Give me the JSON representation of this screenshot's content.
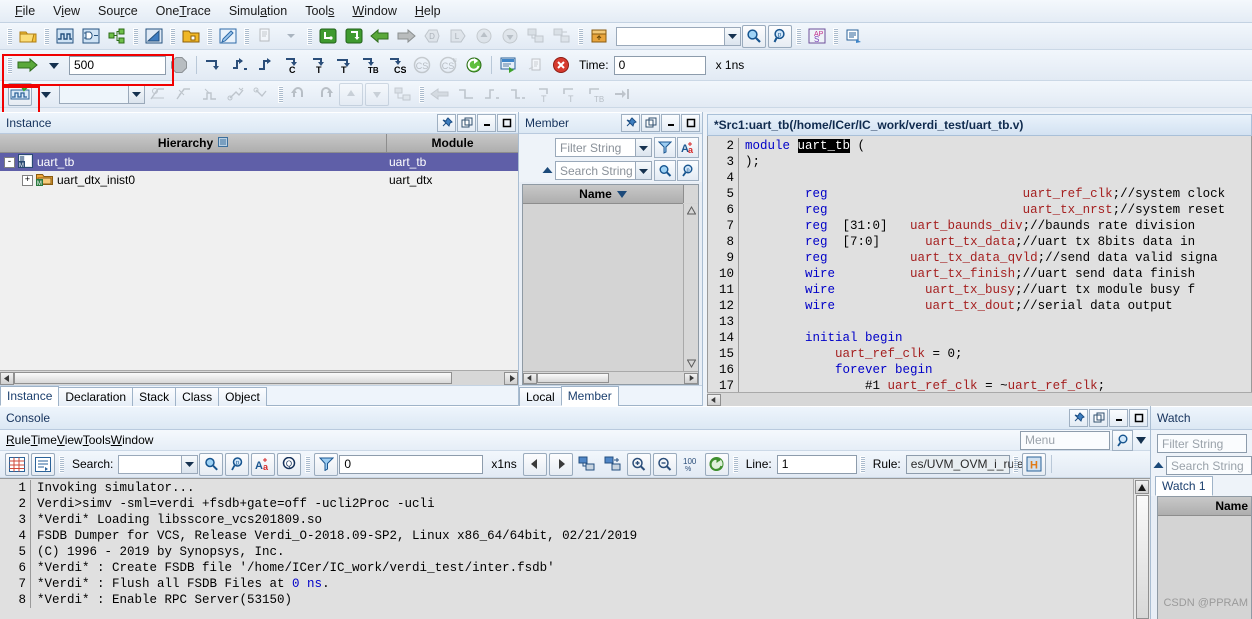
{
  "app": {
    "menu": [
      {
        "label": "File",
        "accel": "F"
      },
      {
        "label": "View",
        "accel": "V"
      },
      {
        "label": "Source",
        "accel": "r"
      },
      {
        "label": "OneTrace",
        "accel": "T"
      },
      {
        "label": "Simulation",
        "accel": "a"
      },
      {
        "label": "Tools",
        "accel": "s"
      },
      {
        "label": "Window",
        "accel": "W"
      },
      {
        "label": "Help",
        "accel": "H"
      }
    ]
  },
  "toolbar_run": {
    "steps_value": "500",
    "steps_placeholder": "",
    "time_label": "Time:",
    "time_value": "0",
    "time_unit": "x 1ns",
    "signal_combo_value": ""
  },
  "toolbar_main": {
    "search_combo_value": ""
  },
  "instance_panel": {
    "title": "Instance",
    "columns": [
      "Hierarchy",
      "Module"
    ],
    "rows": [
      {
        "name": "uart_tb",
        "module": "uart_tb",
        "selected": true,
        "depth": 0,
        "expander": "-"
      },
      {
        "name": "uart_dtx_inist0",
        "module": "uart_dtx",
        "selected": false,
        "depth": 1,
        "expander": "+"
      }
    ],
    "tabs": [
      {
        "label": "Instance",
        "active": true
      },
      {
        "label": "Declaration",
        "active": false
      },
      {
        "label": "Stack",
        "active": false
      },
      {
        "label": "Class",
        "active": false
      },
      {
        "label": "Object",
        "active": false
      }
    ]
  },
  "member_panel": {
    "title": "Member",
    "filter_placeholder": "Filter String",
    "search_placeholder": "Search String",
    "column": "Name",
    "rows": [],
    "tabs": [
      {
        "label": "Local",
        "active": false
      },
      {
        "label": "Member",
        "active": true
      }
    ]
  },
  "editor": {
    "title": "*Src1:uart_tb(/home/ICer/IC_work/verdi_test/uart_tb.v)",
    "lines": [
      {
        "no": "2",
        "segs": [
          {
            "t": "module ",
            "c": "kw"
          },
          {
            "t": "uart_tb",
            "c": "hl"
          },
          {
            "t": " (",
            "c": "cm"
          }
        ]
      },
      {
        "no": "3",
        "segs": [
          {
            "t": ");",
            "c": "cm"
          }
        ]
      },
      {
        "no": "4",
        "segs": []
      },
      {
        "no": "5",
        "segs": [
          {
            "t": "        ",
            "c": "cm"
          },
          {
            "t": "reg",
            "c": "kw"
          },
          {
            "t": "                          ",
            "c": "cm"
          },
          {
            "t": "uart_ref_clk",
            "c": "id"
          },
          {
            "t": ";//system clock",
            "c": "cm"
          }
        ]
      },
      {
        "no": "6",
        "segs": [
          {
            "t": "        ",
            "c": "cm"
          },
          {
            "t": "reg",
            "c": "kw"
          },
          {
            "t": "                          ",
            "c": "cm"
          },
          {
            "t": "uart_tx_nrst",
            "c": "id"
          },
          {
            "t": ";//system reset",
            "c": "cm"
          }
        ]
      },
      {
        "no": "7",
        "segs": [
          {
            "t": "        ",
            "c": "cm"
          },
          {
            "t": "reg",
            "c": "kw"
          },
          {
            "t": "  [31:0]   ",
            "c": "cm"
          },
          {
            "t": "uart_baunds_div",
            "c": "id"
          },
          {
            "t": ";//baunds rate division",
            "c": "cm"
          }
        ]
      },
      {
        "no": "8",
        "segs": [
          {
            "t": "        ",
            "c": "cm"
          },
          {
            "t": "reg",
            "c": "kw"
          },
          {
            "t": "  [7:0]      ",
            "c": "cm"
          },
          {
            "t": "uart_tx_data",
            "c": "id"
          },
          {
            "t": ";//uart tx 8bits data in",
            "c": "cm"
          }
        ]
      },
      {
        "no": "9",
        "segs": [
          {
            "t": "        ",
            "c": "cm"
          },
          {
            "t": "reg",
            "c": "kw"
          },
          {
            "t": "           ",
            "c": "cm"
          },
          {
            "t": "uart_tx_data_qvld",
            "c": "id"
          },
          {
            "t": ";//send data valid signa",
            "c": "cm"
          }
        ]
      },
      {
        "no": "10",
        "segs": [
          {
            "t": "        ",
            "c": "cm"
          },
          {
            "t": "wire",
            "c": "kw"
          },
          {
            "t": "          ",
            "c": "cm"
          },
          {
            "t": "uart_tx_finish",
            "c": "id"
          },
          {
            "t": ";//uart send data finish",
            "c": "cm"
          }
        ]
      },
      {
        "no": "11",
        "segs": [
          {
            "t": "        ",
            "c": "cm"
          },
          {
            "t": "wire",
            "c": "kw"
          },
          {
            "t": "            ",
            "c": "cm"
          },
          {
            "t": "uart_tx_busy",
            "c": "id"
          },
          {
            "t": ";//uart tx module busy f",
            "c": "cm"
          }
        ]
      },
      {
        "no": "12",
        "segs": [
          {
            "t": "        ",
            "c": "cm"
          },
          {
            "t": "wire",
            "c": "kw"
          },
          {
            "t": "            ",
            "c": "cm"
          },
          {
            "t": "uart_tx_dout",
            "c": "id"
          },
          {
            "t": ";//serial data output",
            "c": "cm"
          }
        ]
      },
      {
        "no": "13",
        "segs": []
      },
      {
        "no": "14",
        "segs": [
          {
            "t": "        ",
            "c": "cm"
          },
          {
            "t": "initial begin",
            "c": "kw"
          }
        ]
      },
      {
        "no": "15",
        "segs": [
          {
            "t": "            ",
            "c": "cm"
          },
          {
            "t": "uart_ref_clk",
            "c": "id"
          },
          {
            "t": " = 0;",
            "c": "cm"
          }
        ]
      },
      {
        "no": "16",
        "segs": [
          {
            "t": "            ",
            "c": "cm"
          },
          {
            "t": "forever begin",
            "c": "kw"
          }
        ]
      },
      {
        "no": "17",
        "segs": [
          {
            "t": "                ",
            "c": "cm"
          },
          {
            "t": "#1 ",
            "c": "cm"
          },
          {
            "t": "uart_ref_clk",
            "c": "id"
          },
          {
            "t": " = ~",
            "c": "cm"
          },
          {
            "t": "uart_ref_clk",
            "c": "id"
          },
          {
            "t": ";",
            "c": "cm"
          }
        ]
      }
    ]
  },
  "console": {
    "title": "Console",
    "menu": [
      {
        "label": "Rule",
        "accel": "R"
      },
      {
        "label": "Time",
        "accel": "T"
      },
      {
        "label": "View",
        "accel": "V"
      },
      {
        "label": "Tools",
        "accel": "T"
      },
      {
        "label": "Window",
        "accel": "W"
      }
    ],
    "search_label": "Search:",
    "search_value": "",
    "time_value": "0",
    "time_unit": "x1ns",
    "zoom_label": "100",
    "zoom_sub": "%",
    "line_label": "Line:",
    "line_value": "1",
    "rule_label": "Rule:",
    "rule_value": "es/UVM_OVM_i_rule.rc",
    "menu_placeholder": "Menu",
    "log": [
      {
        "no": "1",
        "segs": [
          {
            "t": "Invoking simulator...",
            "c": "cm"
          }
        ]
      },
      {
        "no": "2",
        "segs": [
          {
            "t": "Verdi>simv -sml=verdi +fsdb+gate=off -ucli2Proc -ucli",
            "c": "cm"
          }
        ]
      },
      {
        "no": "3",
        "segs": [
          {
            "t": "*Verdi* Loading libsscore_vcs201809.so",
            "c": "cm"
          }
        ]
      },
      {
        "no": "4",
        "segs": [
          {
            "t": "FSDB Dumper for VCS, Release Verdi_O-2018.09-SP2, Linux x86_64/64bit, 02/21/2019",
            "c": "cm"
          }
        ]
      },
      {
        "no": "5",
        "segs": [
          {
            "t": "(C) 1996 - 2019 by Synopsys, Inc.",
            "c": "cm"
          }
        ]
      },
      {
        "no": "6",
        "segs": [
          {
            "t": "*Verdi* : Create FSDB file '/home/ICer/IC_work/verdi_test/inter.fsdb'",
            "c": "cm"
          }
        ]
      },
      {
        "no": "7",
        "segs": [
          {
            "t": "*Verdi* : Flush all FSDB Files at ",
            "c": "cm"
          },
          {
            "t": "0 ns",
            "c": "kw"
          },
          {
            "t": ".",
            "c": "cm"
          }
        ]
      },
      {
        "no": "8",
        "segs": [
          {
            "t": "*Verdi* : Enable RPC Server(53150)",
            "c": "cm"
          }
        ]
      }
    ]
  },
  "watch_panel": {
    "title": "Watch",
    "filter_placeholder": "Filter String",
    "search_placeholder": "Search String",
    "tabs": [
      {
        "label": "Watch 1",
        "active": true
      }
    ],
    "column": "Name"
  },
  "watermark": "CSDN @PPRAM",
  "colors": {
    "accent": "#1b63b5",
    "selection": "#5f5fa8",
    "red_highlight": "#f10000",
    "keyword": "#0000c8",
    "identifier": "#a52020"
  }
}
